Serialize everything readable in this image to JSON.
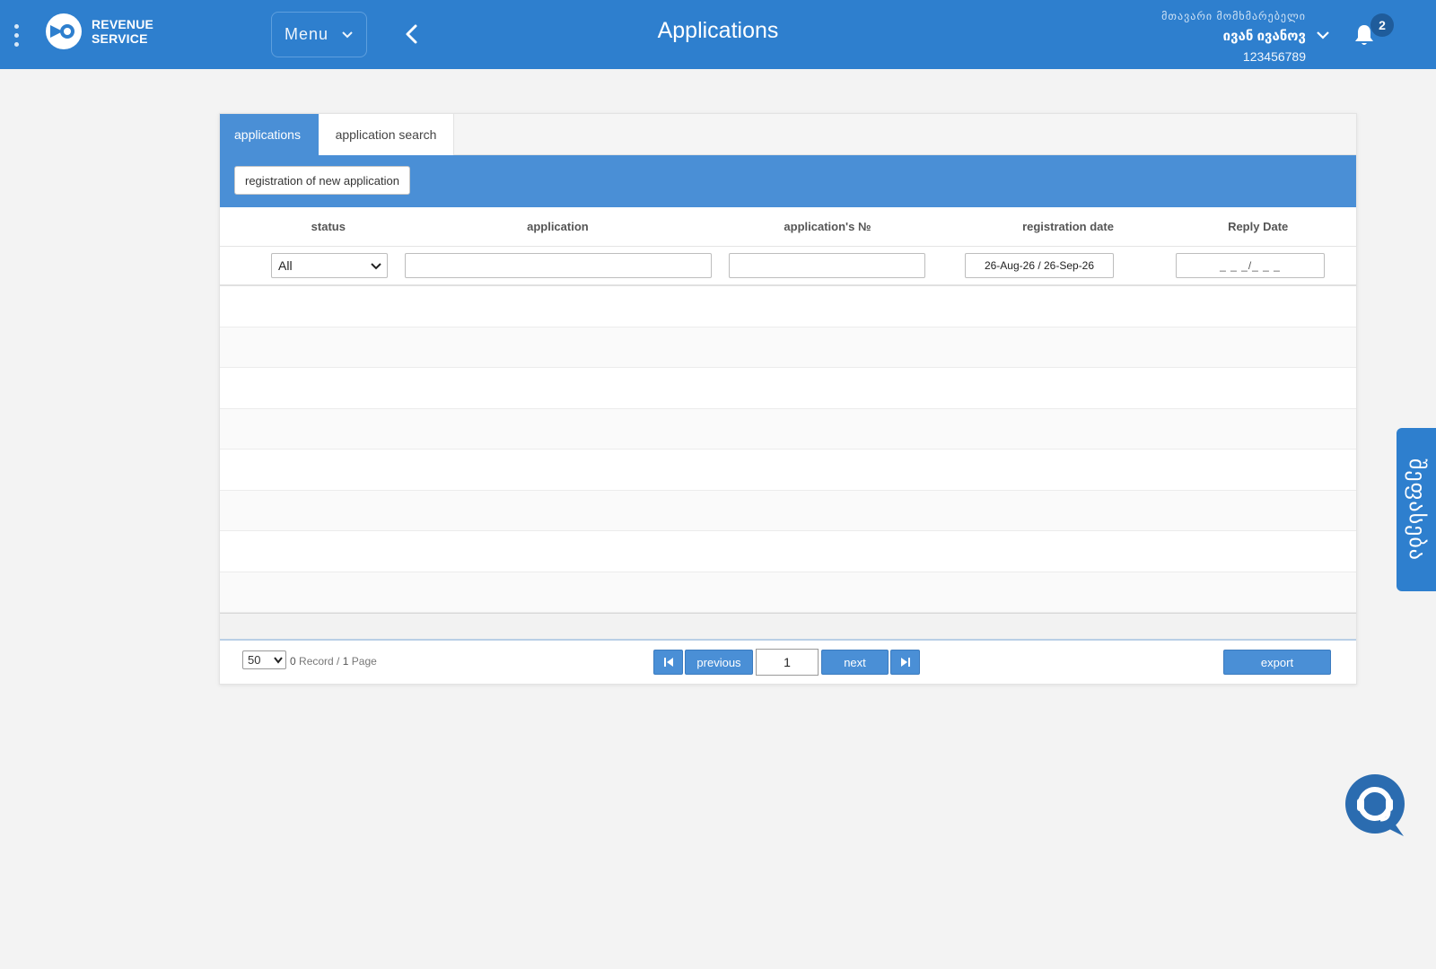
{
  "header": {
    "logo_line1": "REVENUE",
    "logo_line2": "SERVICE",
    "menu_label": "Menu",
    "title": "Applications",
    "user_role": "მთავარი მომხმარებელი",
    "user_name": "ივან ივანოვ",
    "user_id": "123456789",
    "notification_count": "2"
  },
  "tabs": [
    {
      "label": "applications",
      "active": true
    },
    {
      "label": "application search",
      "active": false
    }
  ],
  "toolbar": {
    "new_application_label": "registration of new application"
  },
  "grid": {
    "columns": [
      "status",
      "application",
      "application's №",
      "registration date",
      "Reply Date"
    ],
    "filters": {
      "status_value": "All",
      "application_value": "",
      "application_no_value": "",
      "registration_date_value": "26-Aug-26 / 26-Sep-26",
      "reply_date_placeholder": "_ _ _/_ _ _"
    },
    "rows": []
  },
  "pager": {
    "page_size": "50",
    "record_count": "0",
    "record_label": "Record /",
    "page_count": "1",
    "page_label": "Page",
    "previous_label": "previous",
    "next_label": "next",
    "current_page": "1",
    "export_label": "export"
  },
  "side_tab": {
    "label": "შეფასება"
  },
  "colors": {
    "header_blue": "#2e7fce",
    "toolbar_blue": "#4a8fd6",
    "badge_dark_blue": "#1f5c9b"
  }
}
